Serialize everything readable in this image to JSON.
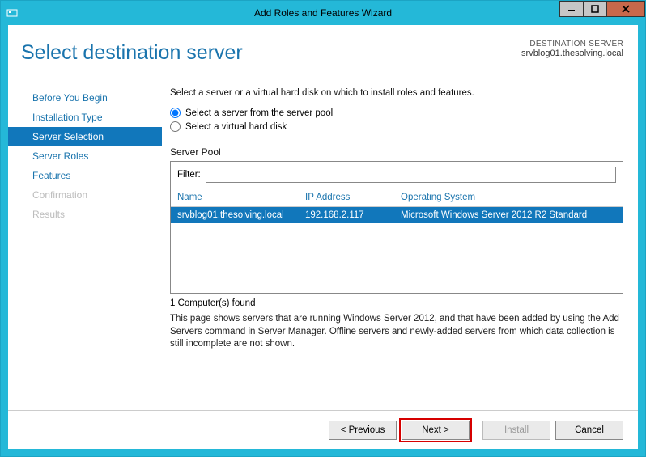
{
  "window": {
    "title": "Add Roles and Features Wizard"
  },
  "page": {
    "title": "Select destination server",
    "dest_label": "DESTINATION SERVER",
    "dest_server": "srvblog01.thesolving.local"
  },
  "sidebar": {
    "items": [
      {
        "label": "Before You Begin",
        "state": "normal"
      },
      {
        "label": "Installation Type",
        "state": "normal"
      },
      {
        "label": "Server Selection",
        "state": "selected"
      },
      {
        "label": "Server Roles",
        "state": "normal"
      },
      {
        "label": "Features",
        "state": "normal"
      },
      {
        "label": "Confirmation",
        "state": "disabled"
      },
      {
        "label": "Results",
        "state": "disabled"
      }
    ]
  },
  "main": {
    "intro": "Select a server or a virtual hard disk on which to install roles and features.",
    "radio1": "Select a server from the server pool",
    "radio2": "Select a virtual hard disk",
    "pool_label": "Server Pool",
    "filter_label": "Filter:",
    "filter_value": "",
    "columns": {
      "name": "Name",
      "ip": "IP Address",
      "os": "Operating System"
    },
    "rows": [
      {
        "name": "srvblog01.thesolving.local",
        "ip": "192.168.2.117",
        "os": "Microsoft Windows Server 2012 R2 Standard"
      }
    ],
    "count": "1 Computer(s) found",
    "desc": "This page shows servers that are running Windows Server 2012, and that have been added by using the Add Servers command in Server Manager. Offline servers and newly-added servers from which data collection is still incomplete are not shown."
  },
  "footer": {
    "previous": "< Previous",
    "next": "Next >",
    "install": "Install",
    "cancel": "Cancel"
  }
}
